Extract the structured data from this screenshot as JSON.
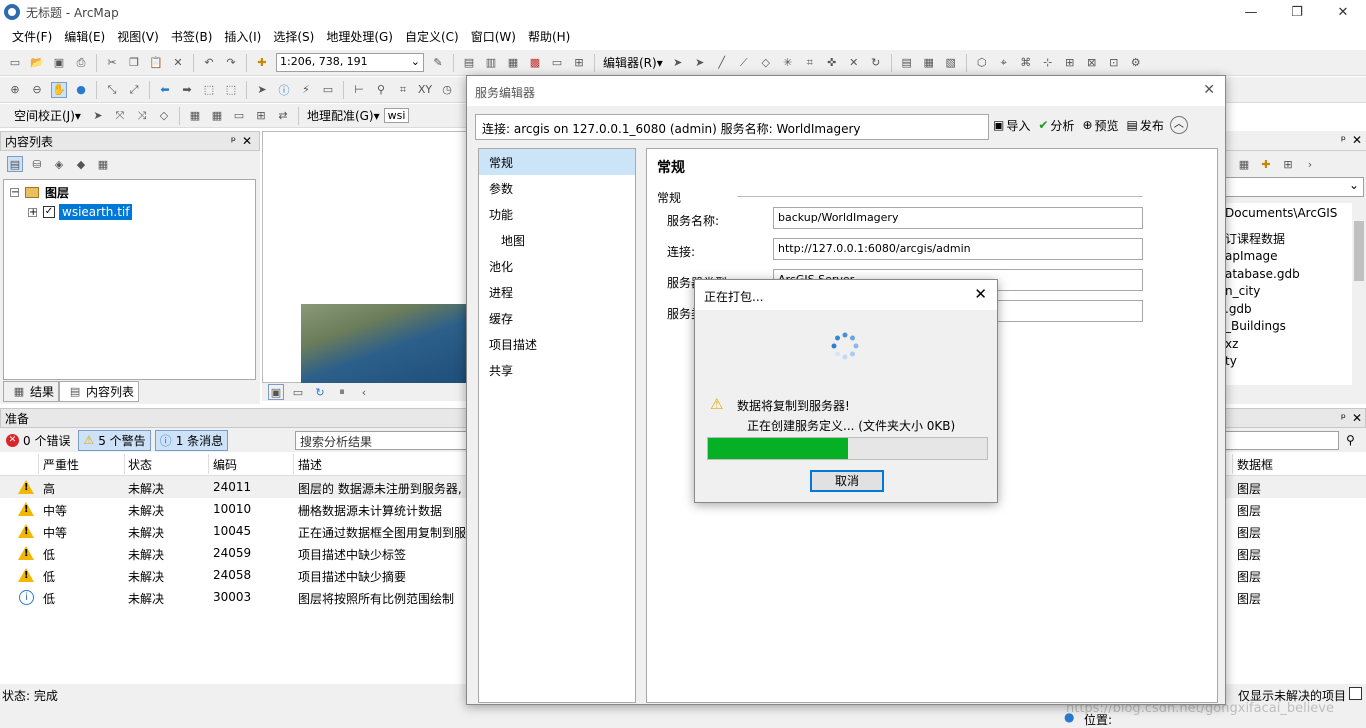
{
  "window": {
    "title": "无标题 - ArcMap",
    "min": "—",
    "max": "❐",
    "close": "✕"
  },
  "menu": [
    "文件(F)",
    "编辑(E)",
    "视图(V)",
    "书签(B)",
    "插入(I)",
    "选择(S)",
    "地理处理(G)",
    "自定义(C)",
    "窗口(W)",
    "帮助(H)"
  ],
  "toolbar": {
    "scale": "1:206, 738, 191",
    "editor": "编辑器(R)▾",
    "spatial_adjust": "空间校正(J)▾",
    "georef": "地理配准(G)▾",
    "georef_layer": "wsi"
  },
  "toc": {
    "title": "内容列表",
    "pin": "ᵖ",
    "close": "✕",
    "layers_label": "图层",
    "layer_name": "wsiearth.tif",
    "tab_results": "结果",
    "tab_toc": "内容列表"
  },
  "catalog": {
    "lines": [
      "Documents\\ArcGIS",
      "订课程数据",
      "apImage",
      "atabase.gdb",
      "n_city",
      ".gdb",
      "_Buildings",
      "xz",
      "ty"
    ]
  },
  "prepare": {
    "title": "准备",
    "errors": "0 个错误",
    "warnings": "5 个警告",
    "messages": "1 条消息",
    "search_placeholder": "搜索分析结果",
    "columns": {
      "severity": "严重性",
      "status": "状态",
      "code": "编码",
      "desc": "描述",
      "frame": "数据框"
    },
    "rows": [
      {
        "icon": "warning",
        "severity": "高",
        "status": "未解决",
        "code": "24011",
        "desc": "图层的  数据源未注册到服务器,",
        "frame": "图层"
      },
      {
        "icon": "warning",
        "severity": "中等",
        "status": "未解决",
        "code": "10010",
        "desc": "栅格数据源未计算统计数据",
        "frame": "图层"
      },
      {
        "icon": "warning",
        "severity": "中等",
        "status": "未解决",
        "code": "10045",
        "desc": "正在通过数据框全图用复制到服",
        "frame": "图层"
      },
      {
        "icon": "warning",
        "severity": "低",
        "status": "未解决",
        "code": "24059",
        "desc": "项目描述中缺少标签",
        "frame": "图层"
      },
      {
        "icon": "warning",
        "severity": "低",
        "status": "未解决",
        "code": "24058",
        "desc": "项目描述中缺少摘要",
        "frame": "图层"
      },
      {
        "icon": "info",
        "severity": "低",
        "status": "未解决",
        "code": "30003",
        "desc": "图层将按照所有比例范围绘制",
        "frame": "图层"
      }
    ]
  },
  "statusbar": {
    "status": "状态: 完成",
    "only_unresolved": "仅显示未解决的项目",
    "position": "位置:",
    "watermark": "https://blog.csdn.net/gongxifacai_believe"
  },
  "service_editor": {
    "title": "服务编辑器",
    "close": "✕",
    "connection": "连接: arcgis on 127.0.0.1_6080 (admin)    服务名称: WorldImagery",
    "btn_import": "导入",
    "btn_analyze": "分析",
    "btn_preview": "预览",
    "btn_publish": "发布",
    "nav": [
      "常规",
      "参数",
      "功能",
      "地图",
      "池化",
      "进程",
      "缓存",
      "项目描述",
      "共享"
    ],
    "section_title": "常规",
    "group": "常规",
    "fields": [
      {
        "label": "服务名称:",
        "value": "backup/WorldImagery"
      },
      {
        "label": "连接:",
        "value": "http://127.0.0.1:6080/arcgis/admin"
      },
      {
        "label": "服务器类型:",
        "value": "ArcGIS Server"
      },
      {
        "label": "服务类",
        "value": ""
      }
    ]
  },
  "packaging": {
    "title": "正在打包...",
    "close": "✕",
    "message": "数据将复制到服务器!",
    "detail": "正在创建服务定义... (文件夹大小 0KB)",
    "progress": 0.5,
    "cancel": "取消"
  },
  "colors": {
    "progress": "#06b025",
    "selection": "#0078d7",
    "accent": "#2a7ad0"
  }
}
